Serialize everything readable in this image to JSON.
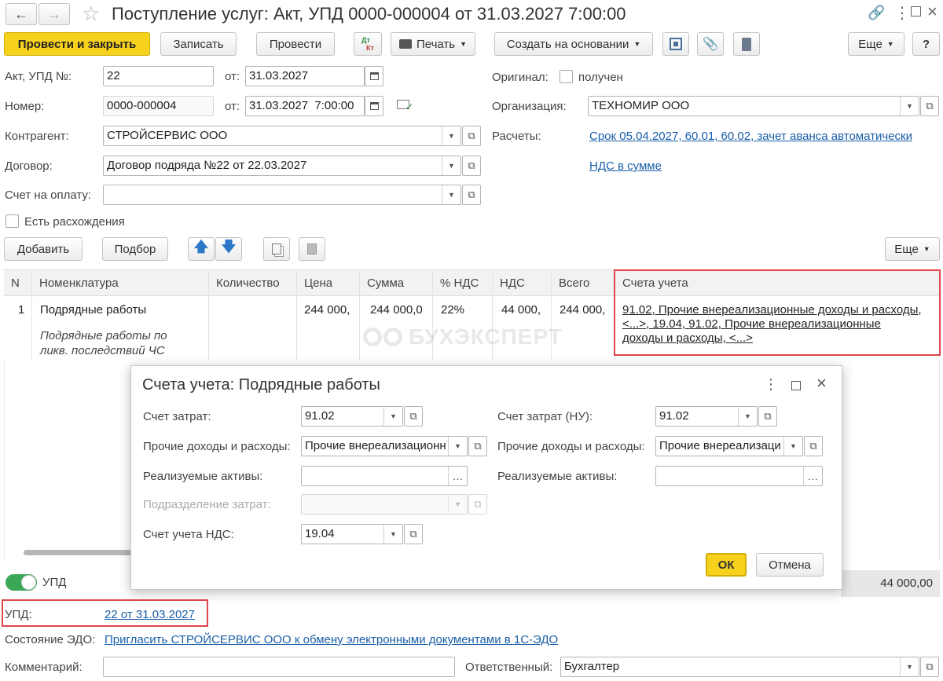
{
  "window": {
    "title": "Поступление услуг: Акт, УПД 0000-000004 от 31.03.2027 7:00:00"
  },
  "toolbar": {
    "post_close": "Провести и закрыть",
    "write": "Записать",
    "post": "Провести",
    "dt": "Дт",
    "kt": "Кт",
    "print": "Печать",
    "create_based": "Создать на основании",
    "more": "Еще",
    "help": "?"
  },
  "form": {
    "act_label": "Акт, УПД №:",
    "act_value": "22",
    "from1_label": "от:",
    "from1_value": "31.03.2027",
    "number_label": "Номер:",
    "number_value": "0000-000004",
    "from2_label": "от:",
    "from2_value": "31.03.2027  7:00:00",
    "contractor_label": "Контрагент:",
    "contractor_value": "СТРОЙСЕРВИС ООО",
    "contract_label": "Договор:",
    "contract_value": "Договор подряда №22 от 22.03.2027",
    "invoice_label": "Счет на оплату:",
    "invoice_value": "",
    "discrepancy_label": "Есть расхождения",
    "original_label": "Оригинал:",
    "original_received": "получен",
    "org_label": "Организация:",
    "org_value": "ТЕХНОМИР ООО",
    "settlements_label": "Расчеты:",
    "settlements_link": "Срок 05.04.2027, 60.01, 60.02, зачет аванса автоматически",
    "vat_link": "НДС в сумме"
  },
  "table_toolbar": {
    "add": "Добавить",
    "pick": "Подбор",
    "more": "Еще"
  },
  "table": {
    "headers": [
      "N",
      "Номенклатура",
      "Количество",
      "Цена",
      "Сумма",
      "% НДС",
      "НДС",
      "Всего",
      "Счета учета"
    ],
    "row": {
      "n": "1",
      "name": "Подрядные работы",
      "desc_line1": "Подрядные работы по",
      "desc_line2": "ликв. последствий ЧС",
      "qty": "",
      "price": "244 000,",
      "sum": "244 000,0",
      "vat_rate": "22%",
      "vat": "44 000,",
      "total": "244 000,",
      "accounts_line1": "91.02, Прочие внереализационные доходы и расходы,",
      "accounts_line2": "<...>, 19.04, 91.02, Прочие внереализационные",
      "accounts_line3": "доходы и расходы, <...>"
    }
  },
  "watermark": "БУХЭКСПЕРТ",
  "footer": {
    "upd_toggle_label": "УПД",
    "total_value": "44 000,00",
    "upd_label": "УПД:",
    "upd_link": "22 от 31.03.2027",
    "edo_label": "Состояние ЭДО:",
    "edo_link": "Пригласить СТРОЙСЕРВИС ООО к обмену электронными документами в 1С-ЭДО",
    "comment_label": "Комментарий:",
    "comment_value": "",
    "responsible_label": "Ответственный:",
    "responsible_value": "Бухгалтер"
  },
  "dialog": {
    "title": "Счета учета: Подрядные работы",
    "cost_account_label": "Счет затрат:",
    "cost_account_value": "91.02",
    "other_ie_label": "Прочие доходы и расходы:",
    "other_ie_value": "Прочие внереализационн",
    "assets_label": "Реализуемые активы:",
    "assets_value": "",
    "division_label": "Подразделение затрат:",
    "division_value": "",
    "vat_account_label": "Счет учета НДС:",
    "vat_account_value": "19.04",
    "cost_account_nu_label": "Счет затрат (НУ):",
    "cost_account_nu_value": "91.02",
    "other_ie_right_label": "Прочие доходы и расходы:",
    "other_ie_right_value": "Прочие внереализаци",
    "assets_right_label": "Реализуемые активы:",
    "assets_right_value": "",
    "ok": "ОК",
    "cancel": "Отмена"
  },
  "colors": {
    "primary_button": "#f7d21d",
    "link": "#1a5fa8",
    "highlight_border": "#e0474c",
    "toggle_on": "#3aa857"
  }
}
